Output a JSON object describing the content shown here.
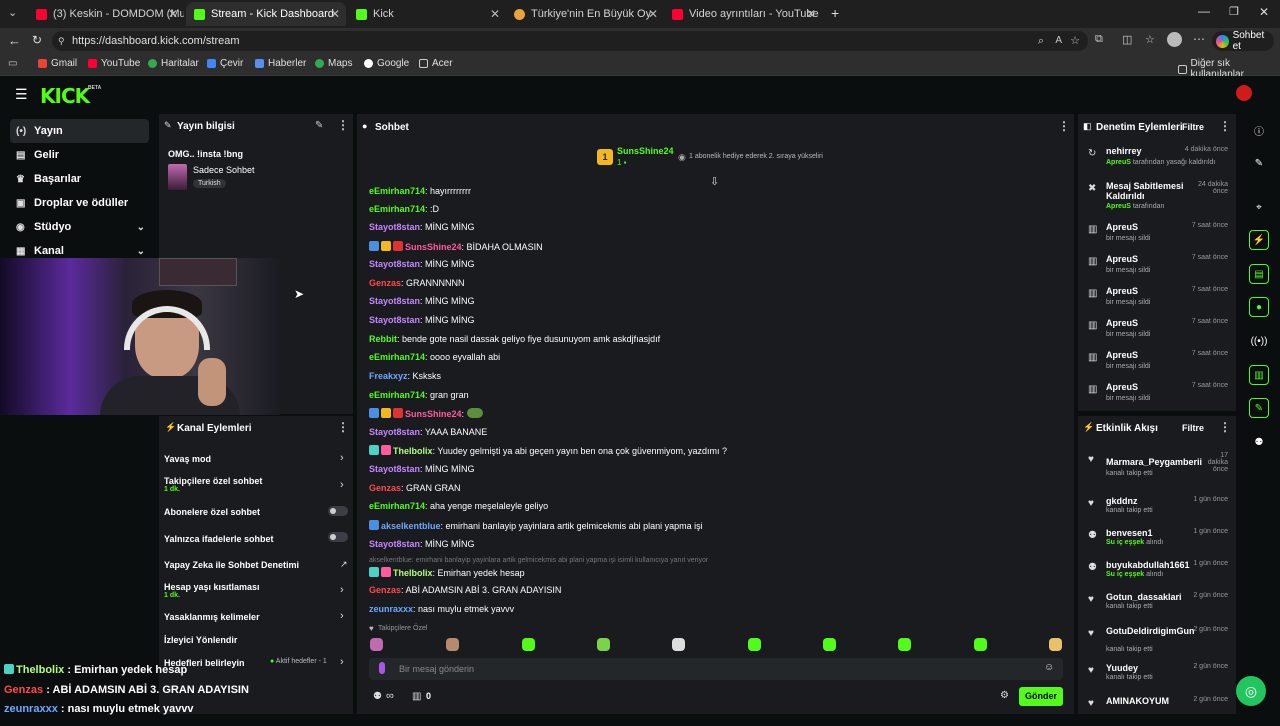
{
  "browser": {
    "tabs": [
      {
        "title": "(3) Keskin - DOMDOM (Music Vide",
        "color": "#ff0033"
      },
      {
        "title": "Stream - Kick Dashboard",
        "color": "#53fc18",
        "active": true
      },
      {
        "title": "Kick",
        "color": "#53fc18"
      },
      {
        "title": "Türkiye'nin En Büyük Oyuncu Dost",
        "color": "#e8a33c"
      },
      {
        "title": "Video ayrıntıları - YouTube Studio",
        "color": "#ff0033"
      }
    ],
    "url": "https://dashboard.kick.com/stream",
    "profile_label": "Sohbet et",
    "bookmarks": [
      "Gmail",
      "YouTube",
      "Haritalar",
      "Çevir",
      "Haberler",
      "Maps",
      "Google",
      "Acer"
    ],
    "other_bookmarks": "Diğer sık kullanılanlar"
  },
  "kick": {
    "logo": "KICK",
    "logo_badge": "BETA",
    "accent": "#53fc18",
    "sidebar": [
      "Yayın",
      "Gelir",
      "Başarılar",
      "Droplar ve ödüller",
      "Stüdyo",
      "Kanal"
    ]
  },
  "stream_info": {
    "title": "Yayın bilgisi",
    "stream_title": "OMG.. !insta !bng",
    "category": "Sadece Sohbet",
    "tag": "Turkish"
  },
  "channel_actions": {
    "title": "Kanal Eylemleri",
    "rows": [
      {
        "label": "Yavaş mod",
        "sub": ""
      },
      {
        "label": "Takipçilere özel sohbet",
        "sub": "1 dk."
      },
      {
        "label": "Abonelere özel sohbet",
        "sub": ""
      },
      {
        "label": "Yalnızca ifadelerle sohbet",
        "sub": ""
      },
      {
        "label": "Yapay Zeka ile Sohbet Denetimi",
        "sub": ""
      },
      {
        "label": "Hesap yaşı kısıtlaması",
        "sub": "1 dk."
      },
      {
        "label": "Yasaklanmış kelimeler",
        "sub": ""
      },
      {
        "label": "İzleyici Yönlendir",
        "sub": ""
      },
      {
        "label": "Hedefleri belirleyin",
        "sub": "Aktif hedefler - 1"
      }
    ]
  },
  "chat": {
    "title": "Sohbet",
    "pinned_user": "SunsShine24",
    "pinned_rank": "1",
    "pinned_text": "1 abonelik hediye ederek 2. sıraya yükseliri",
    "messages": [
      {
        "user": "eEmirhan714",
        "color": "#53fc18",
        "text": "hayırrrrrrrr"
      },
      {
        "user": "eEmirhan714",
        "color": "#53fc18",
        "text": ":D"
      },
      {
        "user": "Stayot8stan",
        "color": "#c785ff",
        "text": "MİNG MİNG"
      },
      {
        "user": "SunsShine24",
        "color": "#ff5b9d",
        "text": "BİDAHA OLMASIN"
      },
      {
        "user": "Stayot8stan",
        "color": "#c785ff",
        "text": "MİNG MİNG"
      },
      {
        "user": "Genzas",
        "color": "#ff4a4a",
        "text": "GRANNNNNN"
      },
      {
        "user": "Stayot8stan",
        "color": "#c785ff",
        "text": "MİNG MİNG"
      },
      {
        "user": "Stayot8stan",
        "color": "#c785ff",
        "text": "MİNG MİNG"
      },
      {
        "user": "Rebbit",
        "color": "#53fc18",
        "text": "bende gote nasil dassak geliyo fiye dusunuyom amk askdjfıasjdıf"
      },
      {
        "user": "eEmirhan714",
        "color": "#53fc18",
        "text": "oooo eyvallah abi"
      },
      {
        "user": "Freakxyz",
        "color": "#6ea7ff",
        "text": "Ksksks"
      },
      {
        "user": "eEmirhan714",
        "color": "#53fc18",
        "text": "gran gran"
      },
      {
        "user": "SunsShine24",
        "color": "#ff5b9d",
        "text": ""
      },
      {
        "user": "Stayot8stan",
        "color": "#c785ff",
        "text": "YAAA BANANE"
      },
      {
        "user": "Thelbolix",
        "color": "#b4ff7a",
        "text": "Yuudey gelmişti ya abi geçen yayın ben ona çok güvenmiyom, yazdımı ?"
      },
      {
        "user": "Stayot8stan",
        "color": "#c785ff",
        "text": "MİNG MİNG"
      },
      {
        "user": "Genzas",
        "color": "#ff4a4a",
        "text": "GRAN GRAN"
      },
      {
        "user": "eEmirhan714",
        "color": "#53fc18",
        "text": "aha yenge meşelaleyle geliyo"
      },
      {
        "user": "akselkentblue",
        "color": "#6ea7ff",
        "text": "emirhani banlayip yayinlara artik gelmicekmis abi plani yapma işi"
      },
      {
        "user": "Stayot8stan",
        "color": "#c785ff",
        "text": "MİNG MİNG"
      },
      {
        "user": "Thelbolix",
        "color": "#b4ff7a",
        "text": "Emirhan yedek hesap"
      },
      {
        "user": "Genzas",
        "color": "#ff4a4a",
        "text": "ABİ ADAMSIN ABİ 3. GRAN ADAYISIN"
      },
      {
        "user": "zeunraxxx",
        "color": "#6ea7ff",
        "text": "nası muylu etmek yavvv"
      }
    ],
    "reply_context": "akselkentblue: emirhani banlayip yayinlara artik gelmicekmis abi plani yapma işi isimli kullanıcıya yanıt veriyor",
    "emote_label": "Takipçilere Özel",
    "input_placeholder": "Bir mesaj gönderin",
    "send_label": "Gönder",
    "viewer_symbol": "∞",
    "count": "0"
  },
  "mod_actions": {
    "title": "Denetim Eylemleri",
    "filter": "Filtre",
    "rows": [
      {
        "name": "nehirrey",
        "time": "4 dakika önce",
        "sub_user": "ApreuS",
        "sub": "tarafından yasağı kaldırıldı"
      },
      {
        "name": "Mesaj Sabitlemesi Kaldırıldı",
        "time": "24 dakika önce",
        "sub_user": "ApreuS",
        "sub": "tarafından"
      },
      {
        "name": "ApreuS",
        "time": "7 saat önce",
        "sub_user": "",
        "sub": "bir mesajı sildi"
      },
      {
        "name": "ApreuS",
        "time": "7 saat önce",
        "sub_user": "",
        "sub": "bir mesajı sildi"
      },
      {
        "name": "ApreuS",
        "time": "7 saat önce",
        "sub_user": "",
        "sub": "bir mesajı sildi"
      },
      {
        "name": "ApreuS",
        "time": "7 saat önce",
        "sub_user": "",
        "sub": "bir mesajı sildi"
      },
      {
        "name": "ApreuS",
        "time": "7 saat önce",
        "sub_user": "",
        "sub": "bir mesajı sildi"
      },
      {
        "name": "ApreuS",
        "time": "7 saat önce",
        "sub_user": "",
        "sub": "bir mesajı sildi"
      }
    ]
  },
  "activity": {
    "title": "Etkinlik Akışı",
    "filter": "Filtre",
    "rows": [
      {
        "name": "Marmara_Peygamberii",
        "time": "17 dakika önce",
        "sub": "kanalı takip etti",
        "green": ""
      },
      {
        "name": "gkddnz",
        "time": "1 gün önce",
        "sub": "kanalı takip etti",
        "green": ""
      },
      {
        "name": "benvesen1",
        "time": "1 gün önce",
        "sub": "alındı",
        "green": "Su iç eşşek"
      },
      {
        "name": "buyukabdullah1661",
        "time": "1 gün önce",
        "sub": "alındı",
        "green": "Su iç eşşek"
      },
      {
        "name": "Gotun_dassaklari",
        "time": "2 gün önce",
        "sub": "kanalı takip etti",
        "green": ""
      },
      {
        "name": "GotuDeldirdigimGun",
        "time": "2 gün önce",
        "sub": "kanalı takip etti",
        "green": ""
      },
      {
        "name": "Yuudey",
        "time": "2 gün önce",
        "sub": "kanalı takip etti",
        "green": ""
      },
      {
        "name": "AMINAKOYUM",
        "time": "2 gün önce",
        "sub": "",
        "green": ""
      }
    ]
  },
  "overlay": {
    "lines": [
      {
        "user": "Thelbolix",
        "color": "#b4ff7a",
        "text": "Emirhan yedek hesap"
      },
      {
        "user": "Genzas",
        "color": "#ff4a4a",
        "text": "ABİ ADAMSIN ABİ 3. GRAN ADAYISIN"
      },
      {
        "user": "zeunraxxx",
        "color": "#6ea7ff",
        "text": "nası muylu etmek yavvv"
      }
    ]
  }
}
